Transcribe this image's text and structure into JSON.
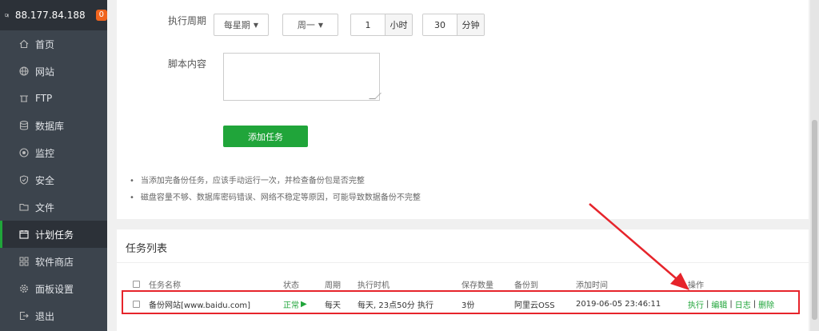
{
  "sidebar": {
    "host": "88.177.84.188",
    "badge": "0",
    "items": [
      {
        "label": "首页",
        "icon": "home-icon"
      },
      {
        "label": "网站",
        "icon": "globe-icon"
      },
      {
        "label": "FTP",
        "icon": "ftp-icon"
      },
      {
        "label": "数据库",
        "icon": "database-icon"
      },
      {
        "label": "监控",
        "icon": "monitor-icon"
      },
      {
        "label": "安全",
        "icon": "shield-icon"
      },
      {
        "label": "文件",
        "icon": "folder-icon"
      },
      {
        "label": "计划任务",
        "icon": "calendar-icon",
        "active": true
      },
      {
        "label": "软件商店",
        "icon": "apps-icon"
      },
      {
        "label": "面板设置",
        "icon": "gear-icon"
      },
      {
        "label": "退出",
        "icon": "logout-icon"
      }
    ]
  },
  "form": {
    "period_label": "执行周期",
    "period_type": "每星期",
    "weekday": "周一",
    "hour_value": "1",
    "hour_unit": "小时",
    "minute_value": "30",
    "minute_unit": "分钟",
    "script_label": "脚本内容",
    "script_value": "",
    "add_button": "添加任务"
  },
  "tips": [
    "当添加完备份任务，应该手动运行一次，并检查备份包是否完整",
    "磁盘容量不够、数据库密码错误、网络不稳定等原因，可能导致数据备份不完整"
  ],
  "task_list": {
    "title": "任务列表",
    "headers": [
      "任务名称",
      "状态",
      "周期",
      "执行时机",
      "保存数量",
      "备份到",
      "添加时间",
      "操作"
    ],
    "rows": [
      {
        "name": "备份网站[www.baidu.com]",
        "status": "正常",
        "status_mark": "▶",
        "period": "每天",
        "timing": "每天, 23点50分 执行",
        "keep": "3份",
        "backup_to": "阿里云OSS",
        "added": "2019-06-05 23:46:11",
        "ops": [
          "执行",
          "编辑",
          "日志",
          "删除"
        ]
      }
    ]
  },
  "colors": {
    "accent": "#20a53a",
    "sidebar_bg": "#3c444d",
    "highlight_red": "#e6242b",
    "badge": "#f0641e"
  }
}
